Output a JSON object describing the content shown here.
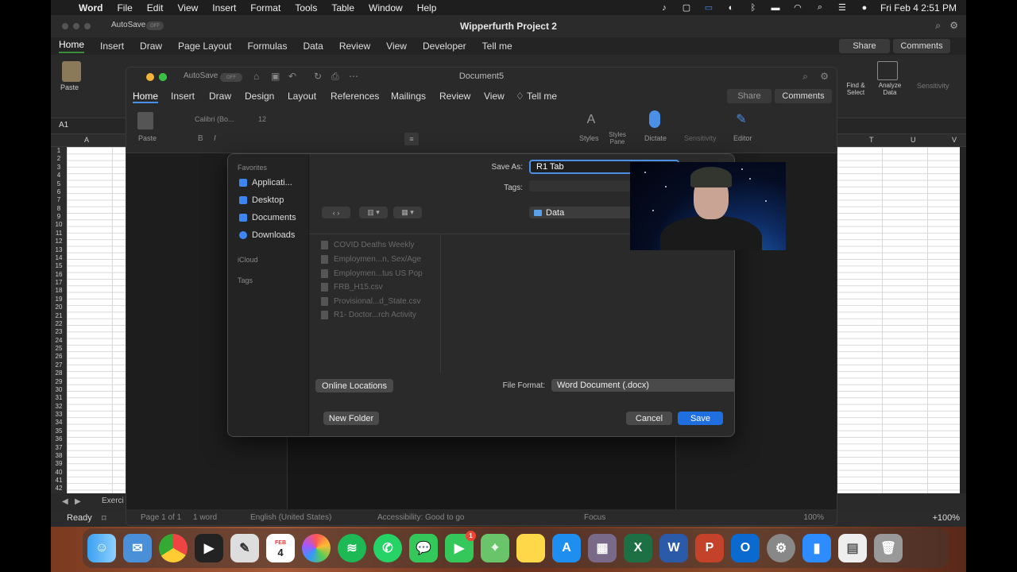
{
  "menubar": {
    "app": "Word",
    "items": [
      "File",
      "Edit",
      "View",
      "Insert",
      "Format",
      "Tools",
      "Table",
      "Window",
      "Help"
    ],
    "datetime": "Fri Feb 4  2:51 PM"
  },
  "excel": {
    "title": "Wipperfurth Project 2",
    "autosave": "AutoSave",
    "autosave_state": "OFF",
    "tabs": [
      "Home",
      "Insert",
      "Draw",
      "Page Layout",
      "Formulas",
      "Data",
      "Review",
      "View",
      "Developer",
      "Tell me"
    ],
    "share": "Share",
    "comments": "Comments",
    "paste": "Paste",
    "find_select": "Find & Select",
    "analyze_data": "Analyze Data",
    "sensitivity": "Sensitivity",
    "name_box": "A1",
    "col_a": "A",
    "cols_right": [
      "T",
      "U",
      "V"
    ],
    "rows": [
      "1",
      "2",
      "3",
      "4",
      "5",
      "6",
      "7",
      "8",
      "9",
      "10",
      "11",
      "12",
      "13",
      "14",
      "15",
      "16",
      "17",
      "18",
      "19",
      "20",
      "21",
      "22",
      "23",
      "24",
      "25",
      "26",
      "27",
      "28",
      "29",
      "30",
      "31",
      "32",
      "33",
      "34",
      "35",
      "36",
      "37",
      "38",
      "39",
      "40",
      "41",
      "42"
    ],
    "sheet_tab": "Exerci",
    "status": "Ready",
    "zoom": "100%"
  },
  "word": {
    "title": "Document5",
    "autosave": "AutoSave",
    "autosave_state": "OFF",
    "tabs": [
      "Home",
      "Insert",
      "Draw",
      "Design",
      "Layout",
      "References",
      "Mailings",
      "Review",
      "View",
      "Tell me"
    ],
    "share": "Share",
    "comments": "Comments",
    "paste": "Paste",
    "font": "Calibri (Bo...",
    "size": "12",
    "styles": "Styles",
    "styles_pane": "Styles Pane",
    "dictate": "Dictate",
    "sensitivity": "Sensitivity",
    "editor": "Editor",
    "status": {
      "page": "Page 1 of 1",
      "words": "1 word",
      "language": "English (United States)",
      "accessibility": "Accessibility: Good to go",
      "focus": "Focus",
      "zoom": "100%"
    }
  },
  "dialog": {
    "sidebar": {
      "favorites": "Favorites",
      "items": [
        "Applicati...",
        "Desktop",
        "Documents",
        "Downloads"
      ],
      "icloud": "iCloud",
      "tags": "Tags"
    },
    "save_as_label": "Save As:",
    "save_as_value": "R1 Tab",
    "tags_label": "Tags:",
    "location": "Data",
    "files": [
      "COVID Deaths Weekly",
      "Employmen...n, Sex/Age",
      "Employmen...tus US Pop",
      "FRB_H15.csv",
      "Provisional...d_State.csv",
      "R1- Doctor...rch Activity"
    ],
    "online_locations": "Online Locations",
    "file_format_label": "File Format:",
    "file_format_value": "Word Document (.docx)",
    "new_folder": "New Folder",
    "cancel": "Cancel",
    "save": "Save"
  },
  "dock": {
    "calendar_month": "FEB",
    "calendar_day": "4",
    "facetime_badge": "1"
  }
}
